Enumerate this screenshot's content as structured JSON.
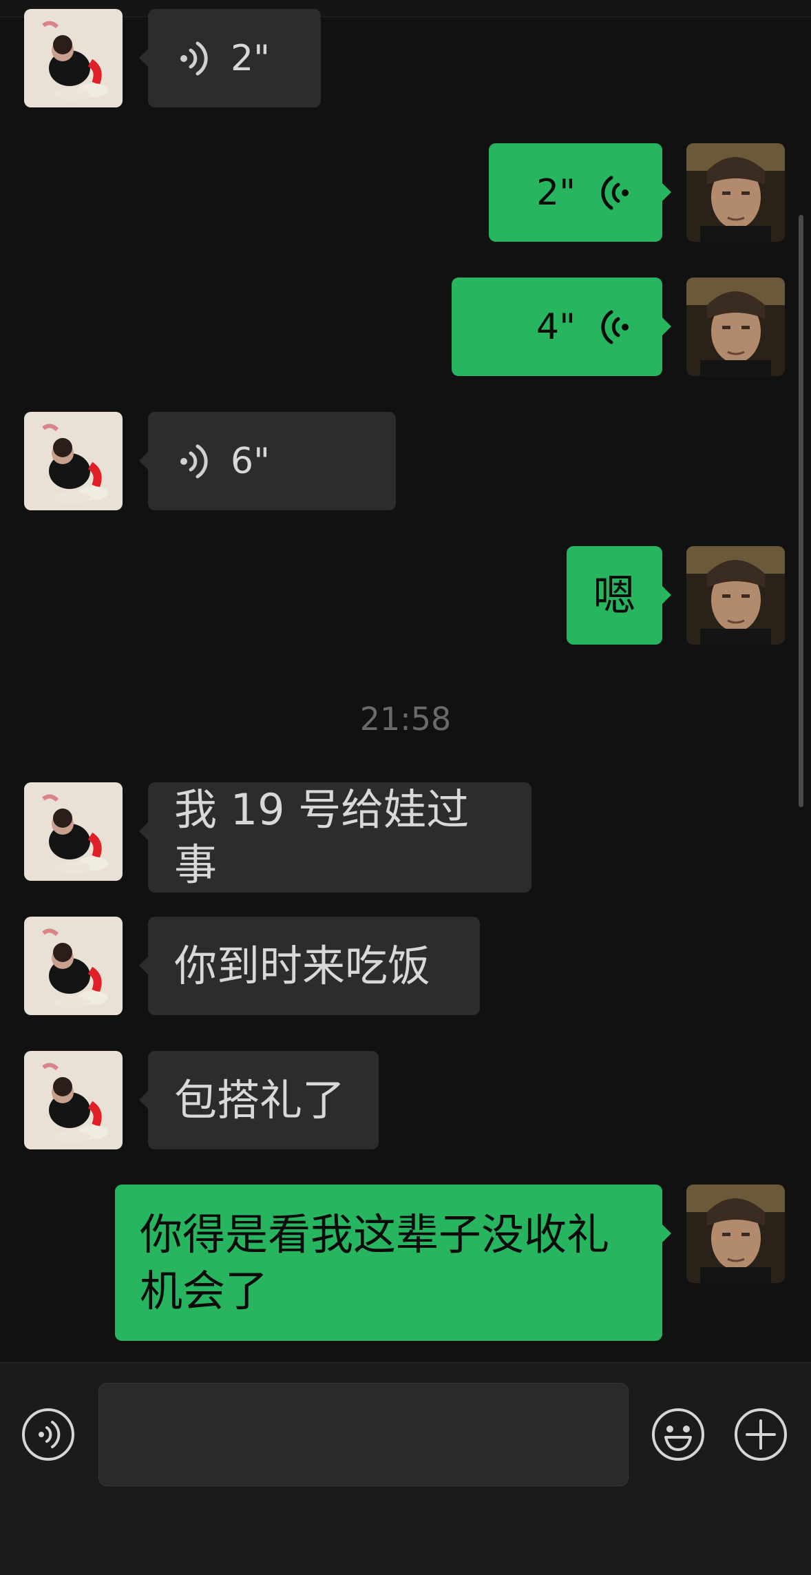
{
  "chat": {
    "messages": [
      {
        "side": "in",
        "type": "voice",
        "duration": "2\""
      },
      {
        "side": "out",
        "type": "voice",
        "duration": "2\""
      },
      {
        "side": "out",
        "type": "voice",
        "duration": "4\""
      },
      {
        "side": "in",
        "type": "voice",
        "duration": "6\""
      },
      {
        "side": "out",
        "type": "text",
        "text": "嗯"
      },
      {
        "side": "sys",
        "type": "timestamp",
        "text": "21:58"
      },
      {
        "side": "in",
        "type": "text",
        "text": "我 19 号给娃过事"
      },
      {
        "side": "in",
        "type": "text",
        "text": "你到时来吃饭"
      },
      {
        "side": "in",
        "type": "text",
        "text": "包搭礼了"
      },
      {
        "side": "out",
        "type": "text",
        "lines": [
          "你得是看我这辈子没收礼",
          "机会了"
        ]
      }
    ]
  },
  "composer": {
    "voice_button_icon": "voice-input-icon",
    "emoji_button_icon": "emoji-icon",
    "plus_button_icon": "plus-icon"
  },
  "colors": {
    "outgoing_bubble": "#27b560",
    "incoming_bubble": "#2c2c2c",
    "background": "#111111"
  }
}
